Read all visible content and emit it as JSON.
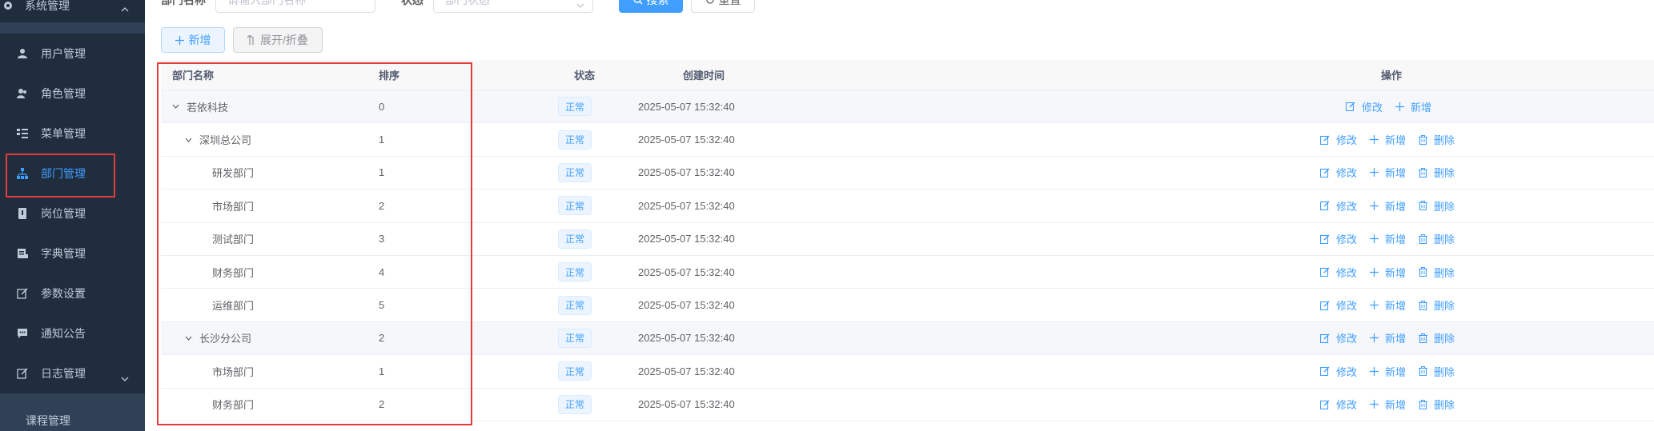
{
  "sidebar": {
    "group_label": "系统管理",
    "items": [
      {
        "label": "用户管理",
        "icon": "user-icon"
      },
      {
        "label": "角色管理",
        "icon": "peoples-icon"
      },
      {
        "label": "菜单管理",
        "icon": "tree-table-icon"
      },
      {
        "label": "部门管理",
        "icon": "tree-icon",
        "active": true
      },
      {
        "label": "岗位管理",
        "icon": "post-icon"
      },
      {
        "label": "字典管理",
        "icon": "dict-icon"
      },
      {
        "label": "参数设置",
        "icon": "edit-icon"
      },
      {
        "label": "通知公告",
        "icon": "message-icon"
      },
      {
        "label": "日志管理",
        "icon": "log-icon"
      }
    ],
    "course_label": "课程管理"
  },
  "search": {
    "dept_label": "部门名称",
    "dept_placeholder": "请输入部门名称",
    "status_label": "状态",
    "status_placeholder": "部门状态",
    "search_btn": "搜索",
    "reset_btn": "重置"
  },
  "toolbar": {
    "add_label": "新增",
    "expand_label": "展开/折叠"
  },
  "table": {
    "headers": {
      "name": "部门名称",
      "sort": "排序",
      "status": "状态",
      "time": "创建时间",
      "ops": "操作"
    },
    "rows": [
      {
        "name": "若依科技",
        "sort": "0",
        "status": "正常",
        "time": "2025-05-07 15:32:40",
        "level": 0,
        "expandable": true,
        "can_delete": false
      },
      {
        "name": "深圳总公司",
        "sort": "1",
        "status": "正常",
        "time": "2025-05-07 15:32:40",
        "level": 1,
        "expandable": true,
        "can_delete": true
      },
      {
        "name": "研发部门",
        "sort": "1",
        "status": "正常",
        "time": "2025-05-07 15:32:40",
        "level": 2,
        "expandable": false,
        "can_delete": true
      },
      {
        "name": "市场部门",
        "sort": "2",
        "status": "正常",
        "time": "2025-05-07 15:32:40",
        "level": 2,
        "expandable": false,
        "can_delete": true
      },
      {
        "name": "测试部门",
        "sort": "3",
        "status": "正常",
        "time": "2025-05-07 15:32:40",
        "level": 2,
        "expandable": false,
        "can_delete": true
      },
      {
        "name": "财务部门",
        "sort": "4",
        "status": "正常",
        "time": "2025-05-07 15:32:40",
        "level": 2,
        "expandable": false,
        "can_delete": true
      },
      {
        "name": "运维部门",
        "sort": "5",
        "status": "正常",
        "time": "2025-05-07 15:32:40",
        "level": 2,
        "expandable": false,
        "can_delete": true
      },
      {
        "name": "长沙分公司",
        "sort": "2",
        "status": "正常",
        "time": "2025-05-07 15:32:40",
        "level": 1,
        "expandable": true,
        "can_delete": true
      },
      {
        "name": "市场部门",
        "sort": "1",
        "status": "正常",
        "time": "2025-05-07 15:32:40",
        "level": 2,
        "expandable": false,
        "can_delete": true
      },
      {
        "name": "财务部门",
        "sort": "2",
        "status": "正常",
        "time": "2025-05-07 15:32:40",
        "level": 2,
        "expandable": false,
        "can_delete": true
      }
    ],
    "op_edit": "修改",
    "op_add": "新增",
    "op_delete": "删除"
  },
  "colors": {
    "sidebar_bg": "#304156",
    "primary": "#409eff",
    "highlight_box": "#e43b3b"
  }
}
